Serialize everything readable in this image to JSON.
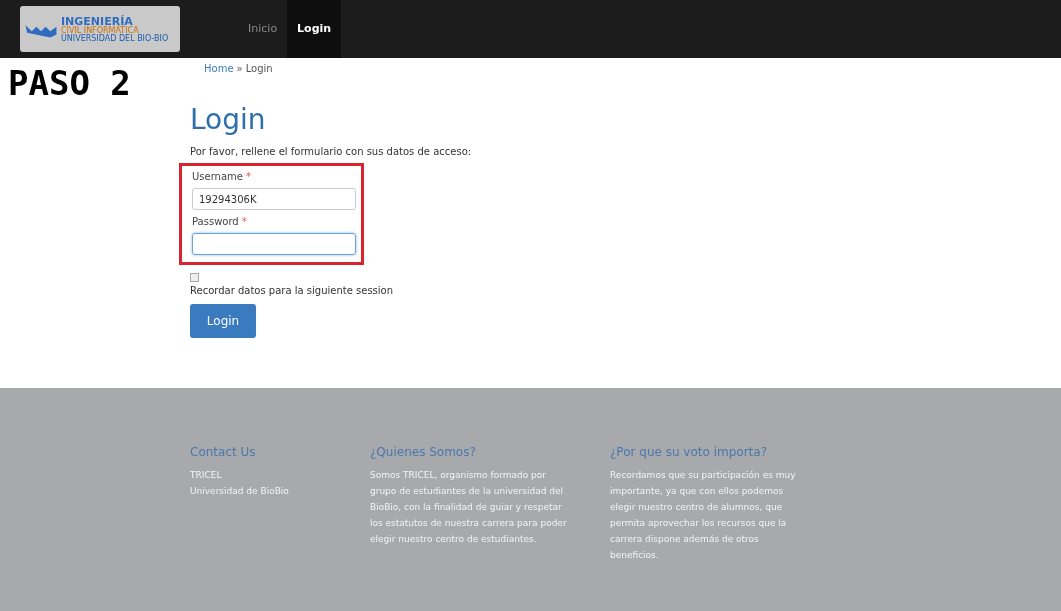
{
  "logo": {
    "title": "INGENIERÍA",
    "subtitle": "CIVIL INFORMÁTICA",
    "caption": "UNIVERSIDAD DEL BIO-BIO"
  },
  "nav": [
    {
      "label": "Inicio",
      "selected": false
    },
    {
      "label": "Login",
      "selected": true
    }
  ],
  "step_label": "PASO 2",
  "breadcrumb": {
    "link": "Home",
    "separator": "»",
    "current": "Login"
  },
  "form": {
    "title": "Login",
    "intro": "Por favor, rellene el formulario con sus datos de acceso:",
    "highlighted": true,
    "fields": [
      {
        "label": "Username",
        "required": "*",
        "value": "19294306K",
        "focused": false
      },
      {
        "label": "Password",
        "required": "*",
        "focused": true
      }
    ],
    "remember": {
      "label": "Recordar datos para la siguiente session",
      "checked": false
    },
    "submit": "Login"
  },
  "footer": [
    {
      "title": "Contact Us",
      "lines": [
        "TRICEL",
        "Universidad de BioBio"
      ]
    },
    {
      "title": "¿Quienes Somos?",
      "lines": [
        "Somos TRICEL, organismo formado por grupo de estudiantes de la universidad del BioBio, con la finalidad de guiar y respetar los estatutos de nuestra carrera para poder elegir nuestro centro de estudiantes."
      ]
    },
    {
      "title": "¿Por que su voto importa?",
      "lines": [
        "Recordamos que su participación es muy importante, ya que con ellos podemos elegir nuestro centro de alumnos, que permita aprovechar los recursos que la carrera dispone además de otros beneficios."
      ]
    }
  ]
}
